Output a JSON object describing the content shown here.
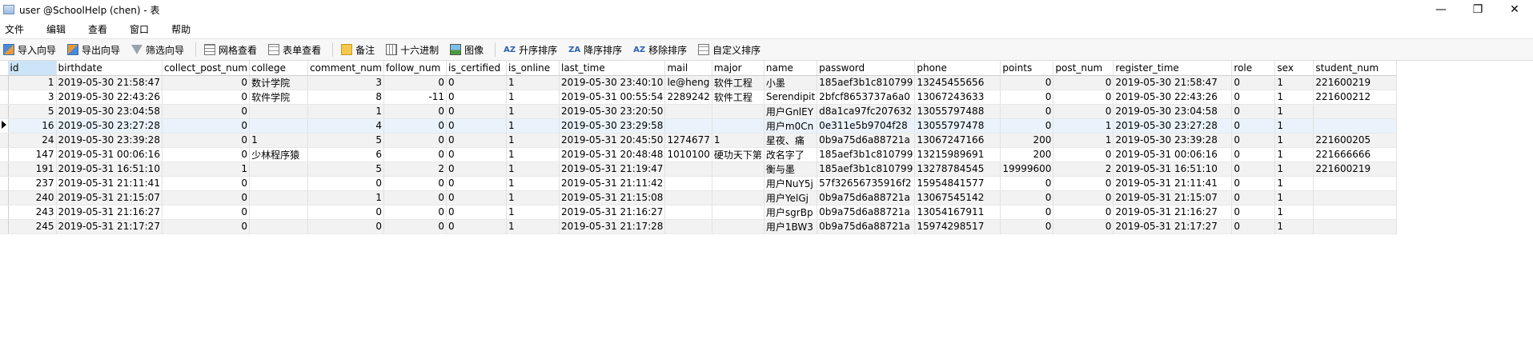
{
  "window": {
    "title": "user @SchoolHelp (chen) - 表",
    "controls": {
      "minimize": "—",
      "restore": "❐",
      "close": "✕"
    }
  },
  "menu": [
    "文件",
    "编辑",
    "查看",
    "窗口",
    "帮助"
  ],
  "toolbar": {
    "import_label": "导入向导",
    "export_label": "导出向导",
    "filter_label": "筛选向导",
    "grid_view_label": "网格查看",
    "form_view_label": "表单查看",
    "note_label": "备注",
    "hex_label": "十六进制",
    "image_label": "图像",
    "sort_asc_label": "升序排序",
    "sort_desc_label": "降序排序",
    "remove_sort_label": "移除排序",
    "custom_sort_label": "自定义排序",
    "sort_asc_glyph": "AZ",
    "sort_desc_glyph": "ZA",
    "remove_sort_glyph": "AZ"
  },
  "table": {
    "columns": [
      "id",
      "birthdate",
      "collect_post_num",
      "college",
      "comment_num",
      "follow_num",
      "is_certified",
      "is_online",
      "last_time",
      "mail",
      "major",
      "name",
      "password",
      "phone",
      "points",
      "post_num",
      "register_time",
      "role",
      "sex",
      "student_num"
    ],
    "selected_column": "id",
    "current_row": 3,
    "rows": [
      [
        "1",
        "2019-05-30 21:58:47",
        "0",
        "数计学院",
        "3",
        "0",
        "0",
        "1",
        "2019-05-30 23:40:10",
        "le@heng",
        "软件工程",
        "小墨",
        "185aef3b1c810799",
        "13245455656",
        "0",
        "0",
        "2019-05-30 21:58:47",
        "0",
        "1",
        "221600219"
      ],
      [
        "3",
        "2019-05-30 22:43:26",
        "0",
        "软件学院",
        "8",
        "-11",
        "0",
        "1",
        "2019-05-31 00:55:54",
        "2289242",
        "软件工程",
        "Serendipit",
        "2bfcf8653737a6a0",
        "13067243633",
        "0",
        "0",
        "2019-05-30 22:43:26",
        "0",
        "1",
        "221600212"
      ],
      [
        "5",
        "2019-05-30 23:04:58",
        "0",
        "",
        "1",
        "0",
        "0",
        "1",
        "2019-05-30 23:20:50",
        "",
        "",
        "用户GnlEY",
        "d8a1ca97fc207632",
        "13055797488",
        "0",
        "0",
        "2019-05-30 23:04:58",
        "0",
        "1",
        ""
      ],
      [
        "16",
        "2019-05-30 23:27:28",
        "0",
        "",
        "4",
        "0",
        "0",
        "1",
        "2019-05-30 23:29:58",
        "",
        "",
        "用户m0Cn",
        "0e311e5b9704f28",
        "13055797478",
        "0",
        "1",
        "2019-05-30 23:27:28",
        "0",
        "1",
        ""
      ],
      [
        "24",
        "2019-05-30 23:39:28",
        "0",
        "1",
        "5",
        "0",
        "0",
        "1",
        "2019-05-31 20:45:50",
        "1274677",
        "1",
        "星夜、痛",
        "0b9a75d6a88721a",
        "13067247166",
        "200",
        "1",
        "2019-05-30 23:39:28",
        "0",
        "1",
        "221600205"
      ],
      [
        "147",
        "2019-05-31 00:06:16",
        "0",
        "少林程序猿",
        "6",
        "0",
        "0",
        "1",
        "2019-05-31 20:48:48",
        "1010100",
        "硬功天下第",
        "改名字了",
        "185aef3b1c810799",
        "13215989691",
        "200",
        "0",
        "2019-05-31 00:06:16",
        "0",
        "1",
        "221666666"
      ],
      [
        "191",
        "2019-05-31 16:51:10",
        "1",
        "",
        "5",
        "2",
        "0",
        "1",
        "2019-05-31 21:19:47",
        "",
        "",
        "衡与墨",
        "185aef3b1c810799",
        "13278784545",
        "19999600",
        "2",
        "2019-05-31 16:51:10",
        "0",
        "1",
        "221600219"
      ],
      [
        "237",
        "2019-05-31 21:11:41",
        "0",
        "",
        "0",
        "0",
        "0",
        "1",
        "2019-05-31 21:11:42",
        "",
        "",
        "用户NuY5j",
        "57f32656735916f2",
        "15954841577",
        "0",
        "0",
        "2019-05-31 21:11:41",
        "0",
        "1",
        ""
      ],
      [
        "240",
        "2019-05-31 21:15:07",
        "0",
        "",
        "1",
        "0",
        "0",
        "1",
        "2019-05-31 21:15:08",
        "",
        "",
        "用户YelGj",
        "0b9a75d6a88721a",
        "13067545142",
        "0",
        "0",
        "2019-05-31 21:15:07",
        "0",
        "1",
        ""
      ],
      [
        "243",
        "2019-05-31 21:16:27",
        "0",
        "",
        "0",
        "0",
        "0",
        "1",
        "2019-05-31 21:16:27",
        "",
        "",
        "用户sgrBp",
        "0b9a75d6a88721a",
        "13054167911",
        "0",
        "0",
        "2019-05-31 21:16:27",
        "0",
        "1",
        ""
      ],
      [
        "245",
        "2019-05-31 21:17:27",
        "0",
        "",
        "0",
        "0",
        "0",
        "1",
        "2019-05-31 21:17:28",
        "",
        "",
        "用户1BW3",
        "0b9a75d6a88721a",
        "15974298517",
        "0",
        "0",
        "2019-05-31 21:17:27",
        "0",
        "1",
        ""
      ]
    ]
  }
}
